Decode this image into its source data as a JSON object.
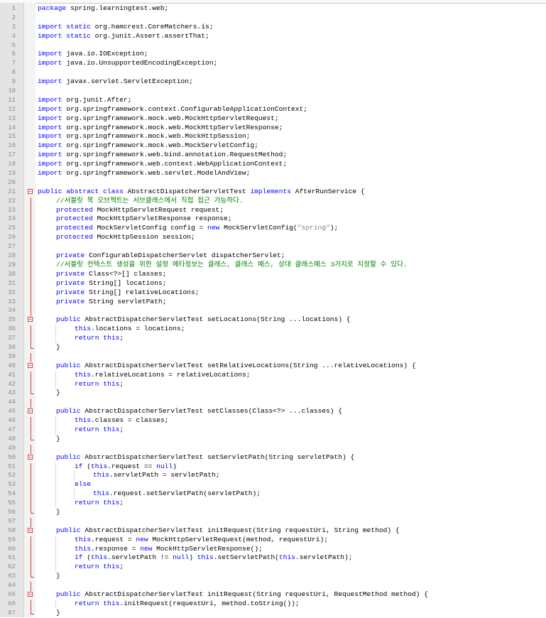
{
  "editor": {
    "lines": [
      {
        "n": "1",
        "t": [
          [
            "package ",
            "kw"
          ],
          [
            "spring.learningtest.web;",
            ""
          ]
        ]
      },
      {
        "n": "2",
        "t": []
      },
      {
        "n": "3",
        "t": [
          [
            "import static ",
            "kw"
          ],
          [
            "org.hamcrest.CoreMatchers.is;",
            ""
          ]
        ]
      },
      {
        "n": "4",
        "t": [
          [
            "import static ",
            "kw"
          ],
          [
            "org.junit.Assert.assertThat;",
            ""
          ]
        ]
      },
      {
        "n": "5",
        "t": []
      },
      {
        "n": "6",
        "t": [
          [
            "import ",
            "kw"
          ],
          [
            "java.io.IOException;",
            ""
          ]
        ]
      },
      {
        "n": "7",
        "t": [
          [
            "import ",
            "kw"
          ],
          [
            "java.io.UnsupportedEncodingException;",
            ""
          ]
        ]
      },
      {
        "n": "8",
        "t": []
      },
      {
        "n": "9",
        "t": [
          [
            "import ",
            "kw"
          ],
          [
            "javax.servlet.ServletException;",
            ""
          ]
        ]
      },
      {
        "n": "10",
        "t": []
      },
      {
        "n": "11",
        "t": [
          [
            "import ",
            "kw"
          ],
          [
            "org.junit.After;",
            ""
          ]
        ]
      },
      {
        "n": "12",
        "t": [
          [
            "import ",
            "kw"
          ],
          [
            "org.springframework.context.ConfigurableApplicationContext;",
            ""
          ]
        ]
      },
      {
        "n": "13",
        "t": [
          [
            "import ",
            "kw"
          ],
          [
            "org.springframework.mock.web.MockHttpServletRequest;",
            ""
          ]
        ]
      },
      {
        "n": "14",
        "t": [
          [
            "import ",
            "kw"
          ],
          [
            "org.springframework.mock.web.MockHttpServletResponse;",
            ""
          ]
        ]
      },
      {
        "n": "15",
        "t": [
          [
            "import ",
            "kw"
          ],
          [
            "org.springframework.mock.web.MockHttpSession;",
            ""
          ]
        ]
      },
      {
        "n": "16",
        "t": [
          [
            "import ",
            "kw"
          ],
          [
            "org.springframework.mock.web.MockServletConfig;",
            ""
          ]
        ]
      },
      {
        "n": "17",
        "t": [
          [
            "import ",
            "kw"
          ],
          [
            "org.springframework.web.bind.annotation.RequestMethod;",
            ""
          ]
        ]
      },
      {
        "n": "18",
        "t": [
          [
            "import ",
            "kw"
          ],
          [
            "org.springframework.web.context.WebApplicationContext;",
            ""
          ]
        ]
      },
      {
        "n": "19",
        "t": [
          [
            "import ",
            "kw"
          ],
          [
            "org.springframework.web.servlet.ModelAndView;",
            ""
          ]
        ]
      },
      {
        "n": "20",
        "t": []
      },
      {
        "n": "21",
        "f": "box",
        "t": [
          [
            "public abstract class ",
            "kw"
          ],
          [
            "AbstractDispatcherServletTest ",
            ""
          ],
          [
            "implements ",
            "kw"
          ],
          [
            "AfterRunService {",
            ""
          ]
        ]
      },
      {
        "n": "22",
        "f": "bar",
        "i": 1,
        "t": [
          [
            "//서블릿 목 오브젝트는 서브클래스에서 직접 접근 가능하다.",
            "cm"
          ]
        ]
      },
      {
        "n": "23",
        "f": "bar",
        "i": 1,
        "t": [
          [
            "protected ",
            "kw"
          ],
          [
            "MockHttpServletRequest request;",
            ""
          ]
        ]
      },
      {
        "n": "24",
        "f": "bar",
        "i": 1,
        "t": [
          [
            "protected ",
            "kw"
          ],
          [
            "MockHttpServletResponse response;",
            ""
          ]
        ]
      },
      {
        "n": "25",
        "f": "bar",
        "i": 1,
        "t": [
          [
            "protected ",
            "kw"
          ],
          [
            "MockServletConfig config = ",
            ""
          ],
          [
            "new ",
            "kw"
          ],
          [
            "MockServletConfig(",
            ""
          ],
          [
            "\"spring\"",
            "st"
          ],
          [
            ");",
            ""
          ]
        ]
      },
      {
        "n": "26",
        "f": "bar",
        "i": 1,
        "t": [
          [
            "protected ",
            "kw"
          ],
          [
            "MockHttpSession session;",
            ""
          ]
        ]
      },
      {
        "n": "27",
        "f": "bar",
        "t": []
      },
      {
        "n": "28",
        "f": "bar",
        "i": 1,
        "t": [
          [
            "private ",
            "kw"
          ],
          [
            "ConfigurableDispatcherServlet dispatcherServlet;",
            ""
          ]
        ]
      },
      {
        "n": "29",
        "f": "bar",
        "i": 1,
        "t": [
          [
            "//서블릿 컨텍스트 생성을 위한 설정 메타정보는 클래스, 클래스 패스, 상대 클래스패스 3가지로 지정할 수 있다.",
            "cm"
          ]
        ]
      },
      {
        "n": "30",
        "f": "bar",
        "i": 1,
        "t": [
          [
            "private ",
            "kw"
          ],
          [
            "Class<?>[] classes;",
            ""
          ]
        ]
      },
      {
        "n": "31",
        "f": "bar",
        "i": 1,
        "t": [
          [
            "private ",
            "kw"
          ],
          [
            "String[] locations;",
            ""
          ]
        ]
      },
      {
        "n": "32",
        "f": "bar",
        "i": 1,
        "t": [
          [
            "private ",
            "kw"
          ],
          [
            "String[] relativeLocations;",
            ""
          ]
        ]
      },
      {
        "n": "33",
        "f": "bar",
        "i": 1,
        "t": [
          [
            "private ",
            "kw"
          ],
          [
            "String servletPath;",
            ""
          ]
        ]
      },
      {
        "n": "34",
        "f": "bar",
        "t": []
      },
      {
        "n": "35",
        "f": "box",
        "i": 1,
        "t": [
          [
            "public ",
            "kw"
          ],
          [
            "AbstractDispatcherServletTest setLocations(String ...locations) {",
            ""
          ]
        ]
      },
      {
        "n": "36",
        "f": "bar",
        "i": 2,
        "t": [
          [
            "this",
            "kw"
          ],
          [
            ".locations = locations;",
            ""
          ]
        ]
      },
      {
        "n": "37",
        "f": "bar",
        "i": 2,
        "t": [
          [
            "return this",
            "kw"
          ],
          [
            ";",
            ""
          ]
        ]
      },
      {
        "n": "38",
        "f": "end",
        "i": 1,
        "t": [
          [
            "}",
            ""
          ]
        ]
      },
      {
        "n": "39",
        "f": "bar",
        "t": []
      },
      {
        "n": "40",
        "f": "box",
        "i": 1,
        "t": [
          [
            "public ",
            "kw"
          ],
          [
            "AbstractDispatcherServletTest setRelativeLocations(String ...relativeLocations) {",
            ""
          ]
        ]
      },
      {
        "n": "41",
        "f": "bar",
        "i": 2,
        "t": [
          [
            "this",
            "kw"
          ],
          [
            ".relativeLocations = relativeLocations;",
            ""
          ]
        ]
      },
      {
        "n": "42",
        "f": "bar",
        "i": 2,
        "t": [
          [
            "return this",
            "kw"
          ],
          [
            ";",
            ""
          ]
        ]
      },
      {
        "n": "43",
        "f": "end",
        "i": 1,
        "t": [
          [
            "}",
            ""
          ]
        ]
      },
      {
        "n": "44",
        "f": "bar",
        "t": []
      },
      {
        "n": "45",
        "f": "box",
        "i": 1,
        "t": [
          [
            "public ",
            "kw"
          ],
          [
            "AbstractDispatcherServletTest setClasses(Class<?> ...classes) {",
            ""
          ]
        ]
      },
      {
        "n": "46",
        "f": "bar",
        "i": 2,
        "t": [
          [
            "this",
            "kw"
          ],
          [
            ".classes = classes;",
            ""
          ]
        ]
      },
      {
        "n": "47",
        "f": "bar",
        "i": 2,
        "t": [
          [
            "return this",
            "kw"
          ],
          [
            ";",
            ""
          ]
        ]
      },
      {
        "n": "48",
        "f": "end",
        "i": 1,
        "t": [
          [
            "}",
            ""
          ]
        ]
      },
      {
        "n": "49",
        "f": "bar",
        "t": []
      },
      {
        "n": "50",
        "f": "box",
        "i": 1,
        "t": [
          [
            "public ",
            "kw"
          ],
          [
            "AbstractDispatcherServletTest setServletPath(String servletPath) {",
            ""
          ]
        ]
      },
      {
        "n": "51",
        "f": "bar",
        "i": 2,
        "t": [
          [
            "if ",
            "kw"
          ],
          [
            "(",
            ""
          ],
          [
            "this",
            "kw"
          ],
          [
            ".request == ",
            ""
          ],
          [
            "null",
            "kw"
          ],
          [
            ")",
            ""
          ]
        ]
      },
      {
        "n": "52",
        "f": "bar",
        "i": 3,
        "t": [
          [
            "this",
            "kw"
          ],
          [
            ".servletPath = servletPath;",
            ""
          ]
        ]
      },
      {
        "n": "53",
        "f": "bar",
        "i": 2,
        "t": [
          [
            "else",
            "kw"
          ]
        ]
      },
      {
        "n": "54",
        "f": "bar",
        "i": 3,
        "t": [
          [
            "this",
            "kw"
          ],
          [
            ".request.setServletPath(servletPath);",
            ""
          ]
        ]
      },
      {
        "n": "55",
        "f": "bar",
        "i": 2,
        "t": [
          [
            "return this",
            "kw"
          ],
          [
            ";",
            ""
          ]
        ]
      },
      {
        "n": "56",
        "f": "end",
        "i": 1,
        "t": [
          [
            "}",
            ""
          ]
        ]
      },
      {
        "n": "57",
        "f": "bar",
        "t": []
      },
      {
        "n": "58",
        "f": "box",
        "i": 1,
        "t": [
          [
            "public ",
            "kw"
          ],
          [
            "AbstractDispatcherServletTest initRequest(String requestUri, String method) {",
            ""
          ]
        ]
      },
      {
        "n": "59",
        "f": "bar",
        "i": 2,
        "t": [
          [
            "this",
            "kw"
          ],
          [
            ".request = ",
            ""
          ],
          [
            "new ",
            "kw"
          ],
          [
            "MockHttpServletRequest(method, requestUri);",
            ""
          ]
        ]
      },
      {
        "n": "60",
        "f": "bar",
        "i": 2,
        "t": [
          [
            "this",
            "kw"
          ],
          [
            ".response = ",
            ""
          ],
          [
            "new ",
            "kw"
          ],
          [
            "MockHttpServletResponse();",
            ""
          ]
        ]
      },
      {
        "n": "61",
        "f": "bar",
        "i": 2,
        "t": [
          [
            "if ",
            "kw"
          ],
          [
            "(",
            ""
          ],
          [
            "this",
            "kw"
          ],
          [
            ".servletPath != ",
            ""
          ],
          [
            "null",
            "kw"
          ],
          [
            ") ",
            ""
          ],
          [
            "this",
            "kw"
          ],
          [
            ".setServletPath(",
            ""
          ],
          [
            "this",
            "kw"
          ],
          [
            ".servletPath);",
            ""
          ]
        ]
      },
      {
        "n": "62",
        "f": "bar",
        "i": 2,
        "t": [
          [
            "return this",
            "kw"
          ],
          [
            ";",
            ""
          ]
        ]
      },
      {
        "n": "63",
        "f": "end",
        "i": 1,
        "t": [
          [
            "}",
            ""
          ]
        ]
      },
      {
        "n": "64",
        "f": "bar",
        "t": []
      },
      {
        "n": "65",
        "f": "box",
        "i": 1,
        "t": [
          [
            "public ",
            "kw"
          ],
          [
            "AbstractDispatcherServletTest initRequest(String requestUri, RequestMethod method) {",
            ""
          ]
        ]
      },
      {
        "n": "66",
        "f": "bar",
        "i": 2,
        "t": [
          [
            "return this",
            "kw"
          ],
          [
            ".initRequest(requestUri, method.toString());",
            ""
          ]
        ]
      },
      {
        "n": "67",
        "f": "end",
        "i": 1,
        "t": [
          [
            "}",
            ""
          ]
        ]
      }
    ]
  }
}
